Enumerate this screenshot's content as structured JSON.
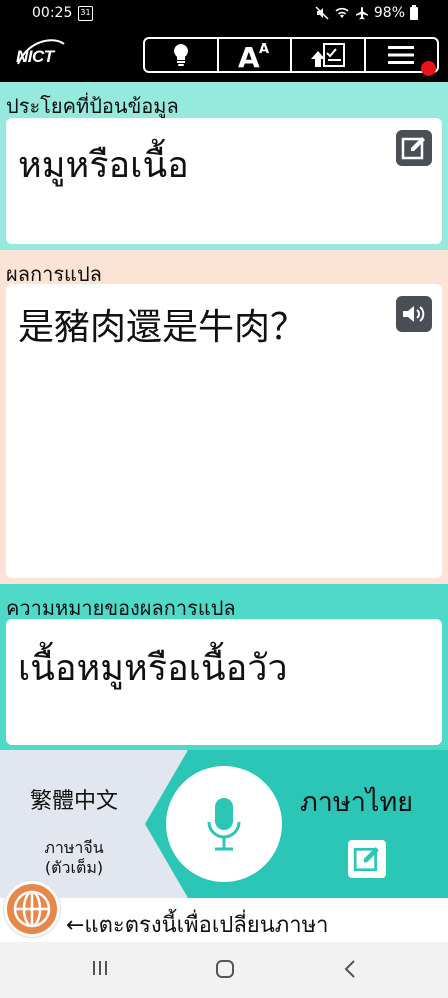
{
  "status_bar": {
    "time": "00:25",
    "calendar_day": "31",
    "battery": "98%"
  },
  "toolbar": {
    "logo": "NICT",
    "buttons": [
      {
        "name": "hint",
        "icon": "lightbulb-icon"
      },
      {
        "name": "font-size",
        "icon": "font-size-icon"
      },
      {
        "name": "history",
        "icon": "upload-list-icon"
      },
      {
        "name": "menu",
        "icon": "hamburger-menu-icon"
      }
    ],
    "has_notification": true
  },
  "input_section": {
    "label": "ประโยคที่ป้อนข้อมูล",
    "text": "หมูหรือเนื้อ"
  },
  "translation_section": {
    "label": "ผลการแปล",
    "text": "是豬肉還是牛肉？"
  },
  "back_translation_section": {
    "label": "ความหมายของผลการแปล",
    "text": "เนื้อหมูหรือเนื้อวัว"
  },
  "language": {
    "source_name": "繁體中文",
    "source_sub_line1": "ภาษาจีน",
    "source_sub_line2": "(ตัวเต็ม)",
    "target_name": "ภาษาไทย"
  },
  "switch_hint": "←แตะตรงนี้เพื่อเปลี่ยนภาษา",
  "colors": {
    "input_bg": "#95e9dd",
    "translation_bg": "#fbe3d5",
    "back_bg": "#4fd9c9",
    "accent_teal": "#2bc6b6",
    "globe_orange": "#e8874a"
  }
}
